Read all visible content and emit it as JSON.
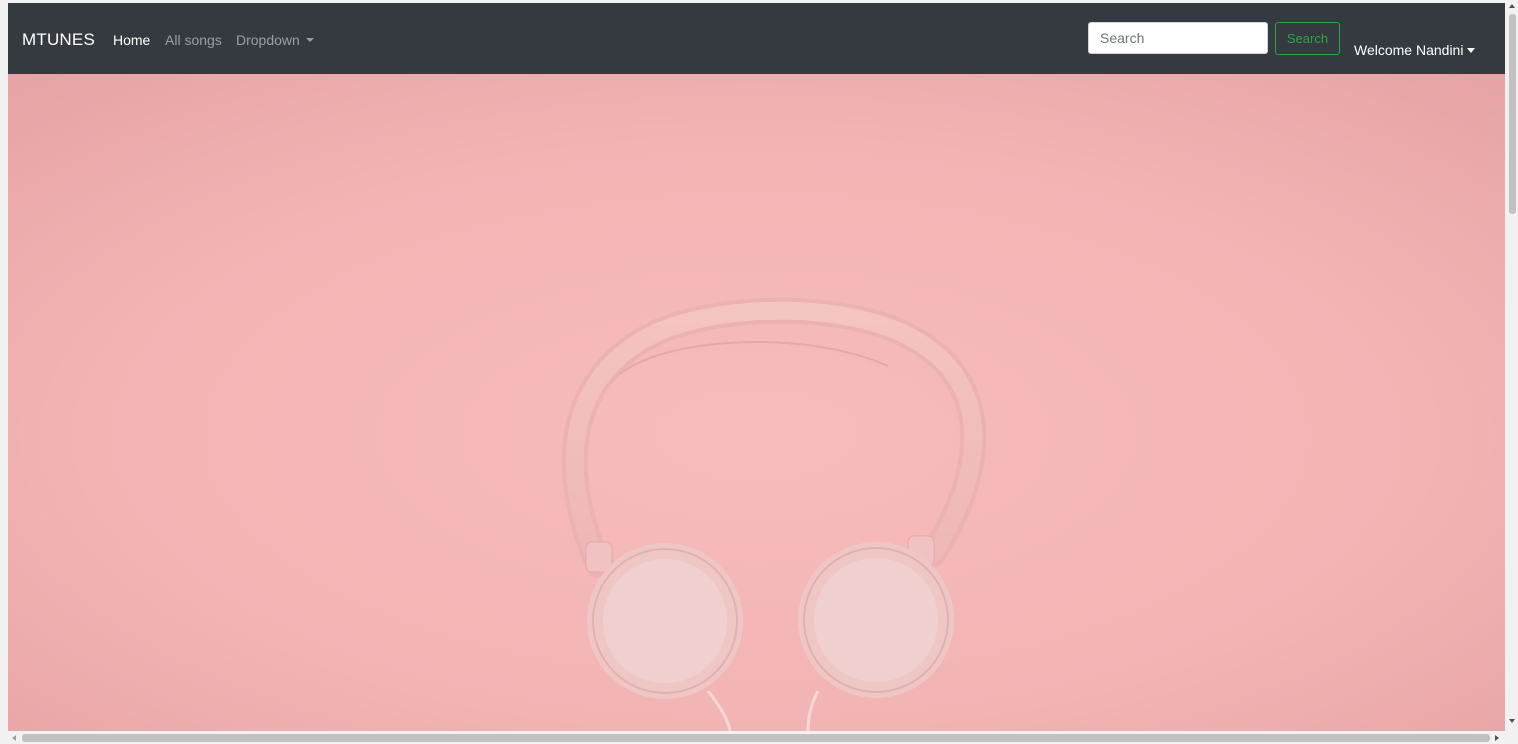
{
  "navbar": {
    "brand": "MTUNES",
    "links": [
      {
        "label": "Home",
        "active": true
      },
      {
        "label": "All songs",
        "active": false
      },
      {
        "label": "Dropdown",
        "active": false
      }
    ],
    "search": {
      "placeholder": "Search",
      "button_label": "Search"
    },
    "user_menu": "Welcome Nandini"
  },
  "hero": {
    "image_subject": "headphones",
    "background_color": "#f3b5b5"
  },
  "colors": {
    "navbar": "#343a40",
    "search_accent": "#28a745",
    "headphone": "#f2c8c6"
  }
}
